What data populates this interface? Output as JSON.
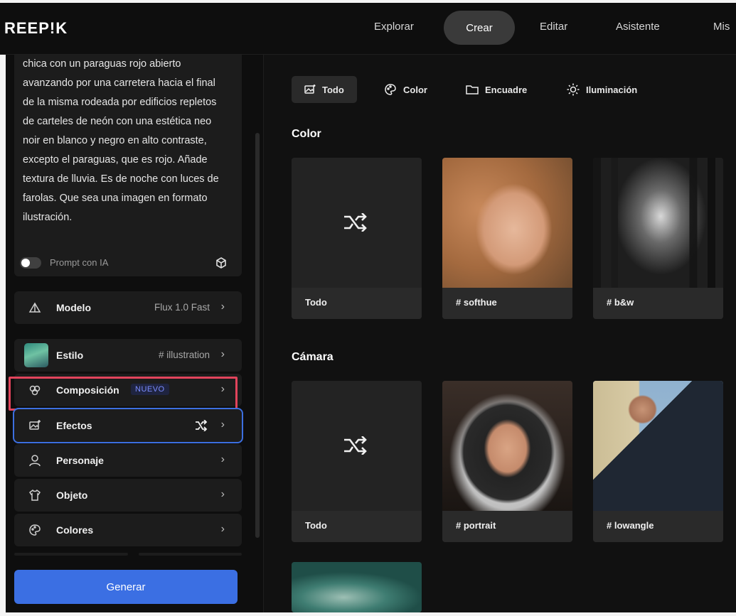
{
  "app": {
    "logo": "REEP!K"
  },
  "nav": {
    "items": [
      "Explorar",
      "Crear",
      "Editar",
      "Asistente",
      "Mis"
    ],
    "active": "Crear"
  },
  "prompt": {
    "text": "chica con un paraguas rojo abierto avanzando por una carretera hacia el final de la misma rodeada por edificios repletos de carteles de neón con una estética neo noir en blanco y negro en alto contraste, excepto el paraguas, que es rojo. Añade textura de lluvia. Es de noche con luces de farolas. Que sea una imagen en formato ilustración.",
    "ai_toggle_label": "Prompt con IA",
    "ai_toggle_on": false
  },
  "settings": {
    "modelo": {
      "label": "Modelo",
      "value": "Flux 1.0 Fast"
    },
    "estilo": {
      "label": "Estilo",
      "value": "# illustration"
    },
    "composicion": {
      "label": "Composición",
      "badge": "NUEVO"
    },
    "efectos": {
      "label": "Efectos"
    },
    "personaje": {
      "label": "Personaje"
    },
    "objeto": {
      "label": "Objeto"
    },
    "colores": {
      "label": "Colores"
    }
  },
  "generate_label": "Generar",
  "filters": {
    "items": [
      "Todo",
      "Color",
      "Encuadre",
      "Iluminación"
    ],
    "active": "Todo"
  },
  "sections": {
    "color": {
      "title": "Color",
      "cards": [
        {
          "label": "Todo",
          "icon": "shuffle-icon"
        },
        {
          "label": "# softhue"
        },
        {
          "label": "# b&w"
        }
      ]
    },
    "camara": {
      "title": "Cámara",
      "cards": [
        {
          "label": "Todo",
          "icon": "shuffle-icon"
        },
        {
          "label": "# portrait"
        },
        {
          "label": "# lowangle"
        }
      ]
    }
  },
  "colors": {
    "accent": "#3b6fe3",
    "highlight": "#e2445c",
    "panel": "#1c1c1c"
  }
}
